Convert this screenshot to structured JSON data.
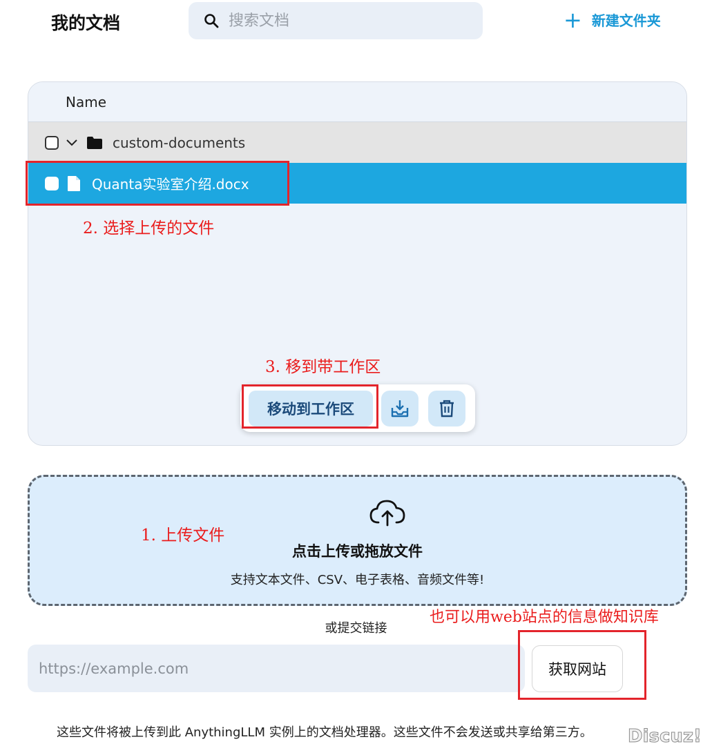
{
  "header": {
    "title": "我的文档",
    "search_placeholder": "搜索文档",
    "new_folder_label": "新建文件夹"
  },
  "file_table": {
    "column_name": "Name",
    "rows": [
      {
        "type": "folder",
        "name": "custom-documents",
        "expanded": true,
        "selected": false
      },
      {
        "type": "file",
        "name": "Quanta实验室介绍.docx",
        "selected": true
      }
    ]
  },
  "actions": {
    "move_to_workspace_label": "移动到工作区"
  },
  "upload": {
    "title": "点击上传或拖放文件",
    "subtitle": "支持文本文件、CSV、电子表格、音频文件等!"
  },
  "link": {
    "or_submit_link": "或提交链接",
    "url_placeholder": "https://example.com",
    "fetch_button_label": "获取网站"
  },
  "footer": {
    "notice": "这些文件将被上传到此 AnythingLLM 实例上的文档处理器。这些文件不会发送或共享给第三方。"
  },
  "annotations": {
    "step1": "1. 上传文件",
    "step2": "2. 选择上传的文件",
    "step3": "3. 移到带工作区",
    "note_web": "也可以用web站点的信息做知识库"
  },
  "watermark": "Discuz!",
  "colors": {
    "accent": "#1a98d6",
    "selected_row": "#1da7e0",
    "annotation_red": "#e3242b",
    "dropzone_bg": "#dcedfc"
  }
}
